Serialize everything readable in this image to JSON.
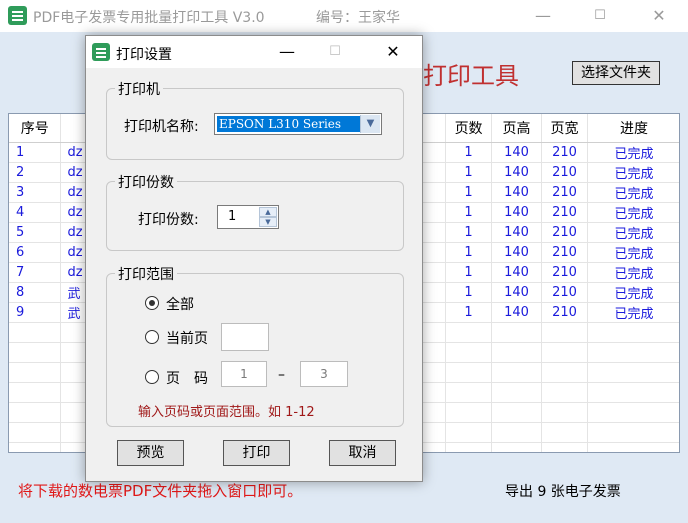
{
  "main_window": {
    "title": "PDF电子发票专用批量打印工具 V3.0",
    "author": "编号：王家华",
    "minimize": "—",
    "maximize": "☐",
    "close": "✕",
    "heading": "打印工具",
    "choose_folder_label": "选择文件夹",
    "table": {
      "headers": [
        "序号",
        "",
        "",
        "页数",
        "页高",
        "页宽",
        "进度"
      ],
      "rows": [
        [
          "1",
          "dz",
          ".",
          "1",
          "140",
          "210",
          "已完成"
        ],
        [
          "2",
          "dz",
          ".",
          "1",
          "140",
          "210",
          "已完成"
        ],
        [
          "3",
          "dz",
          ".",
          "1",
          "140",
          "210",
          "已完成"
        ],
        [
          "4",
          "dz",
          ".",
          "1",
          "140",
          "210",
          "已完成"
        ],
        [
          "5",
          "dz",
          ".",
          "1",
          "140",
          "210",
          "已完成"
        ],
        [
          "6",
          "dz",
          ".",
          "1",
          "140",
          "210",
          "已完成"
        ],
        [
          "7",
          "dz",
          ".",
          "1",
          "140",
          "210",
          "已完成"
        ],
        [
          "8",
          "武",
          "",
          "1",
          "140",
          "210",
          "已完成"
        ],
        [
          "9",
          "武",
          "",
          "1",
          "140",
          "210",
          "已完成"
        ]
      ]
    },
    "drag_hint": "将下载的数电票PDF文件夹拖入窗口即可。",
    "export_status": "导出 9 张电子发票"
  },
  "dialog": {
    "title": "打印设置",
    "minimize": "—",
    "maximize": "☐",
    "close": "✕",
    "printer_group": "打印机",
    "printer_name_label": "打印机名称:",
    "printer_name_value": "EPSON L310 Series",
    "copies_group": "打印份数",
    "copies_label": "打印份数:",
    "copies_value": "1",
    "range_group": "打印范围",
    "range_options": [
      {
        "label": "全部",
        "selected": true
      },
      {
        "label": "当前页",
        "selected": false
      },
      {
        "label": "页　码",
        "selected": false
      }
    ],
    "page_from": "1",
    "page_dash": "–",
    "page_to": "3",
    "range_hint": "输入页码或页面范围。如 1-12",
    "buttons": {
      "preview": "预览",
      "print": "打印",
      "cancel": "取消"
    }
  },
  "colors": {
    "client_bg": "#dfe9f4",
    "row_text": "#1a1adc",
    "hint_red": "#e01818",
    "selection": "#0078d7"
  }
}
